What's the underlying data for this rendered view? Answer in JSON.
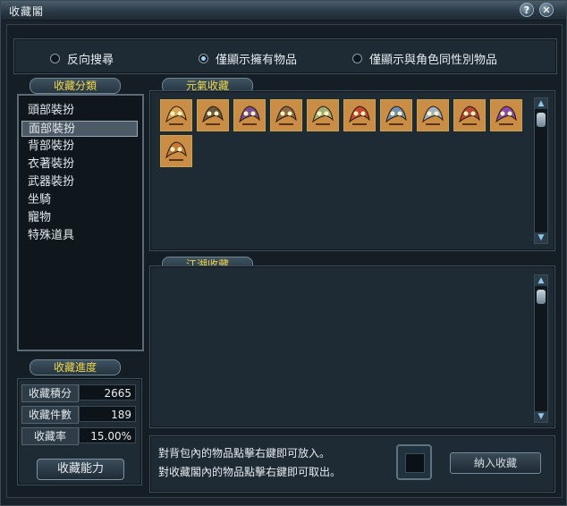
{
  "window": {
    "title": "收藏閣",
    "help_label": "?",
    "close_label": "✕"
  },
  "filters": [
    {
      "label": "反向搜尋",
      "selected": false
    },
    {
      "label": "僅顯示擁有物品",
      "selected": true
    },
    {
      "label": "僅顯示與角色同性別物品",
      "selected": false
    }
  ],
  "categories": {
    "header": "收藏分類",
    "items": [
      "頭部裝扮",
      "面部裝扮",
      "背部裝扮",
      "衣著裝扮",
      "武器裝扮",
      "坐騎",
      "寵物",
      "特殊道具"
    ],
    "selected_index": 1
  },
  "yuanqi": {
    "header": "元氣收藏",
    "items": [
      {
        "icon": "golden-dragon-mask-icon",
        "color": "#d8a24f"
      },
      {
        "icon": "dark-winged-mask-icon",
        "color": "#6b5a3a"
      },
      {
        "icon": "purple-horned-mask-icon",
        "color": "#7b4f8f"
      },
      {
        "icon": "bronze-mask-icon",
        "color": "#8c6a44"
      },
      {
        "icon": "jade-ornament-mask-icon",
        "color": "#a0b070"
      },
      {
        "icon": "red-orb-mask-icon",
        "color": "#c84a2a"
      },
      {
        "icon": "blue-feather-mask-icon",
        "color": "#6f8fb3"
      },
      {
        "icon": "silver-crescent-mask-icon",
        "color": "#9fb3c4"
      },
      {
        "icon": "crimson-crown-mask-icon",
        "color": "#b5482e"
      },
      {
        "icon": "violet-gem-mask-icon",
        "color": "#8a4aa3"
      },
      {
        "icon": "amber-leaf-mask-icon",
        "color": "#c27a34"
      }
    ]
  },
  "jianghu": {
    "header": "江湖收藏"
  },
  "progress": {
    "header": "收藏進度",
    "rows": [
      {
        "label": "收藏積分",
        "value": "2665"
      },
      {
        "label": "收藏件數",
        "value": "189"
      },
      {
        "label": "收藏率",
        "value": "15.00%"
      }
    ],
    "ability_button": "收藏能力"
  },
  "bottom": {
    "hint_1": "對背包內的物品點擊右鍵即可放入。",
    "hint_2": "對收藏閣內的物品點擊右鍵即可取出。",
    "collect_button": "納入收藏"
  }
}
